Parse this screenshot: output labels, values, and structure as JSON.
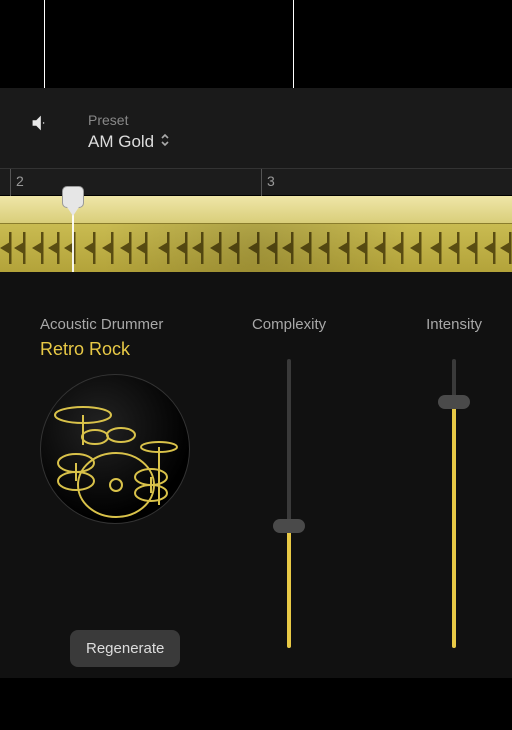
{
  "header": {
    "preset_label": "Preset",
    "preset_value": "AM Gold"
  },
  "ruler": {
    "bars": [
      "2",
      "3"
    ]
  },
  "drummer": {
    "category": "Acoustic Drummer",
    "name": "Retro Rock"
  },
  "sliders": {
    "complexity": {
      "label": "Complexity",
      "value": 0.42
    },
    "intensity": {
      "label": "Intensity",
      "value": 0.85
    }
  },
  "regenerate_label": "Regenerate",
  "colors": {
    "accent": "#e8c946",
    "background": "#111"
  }
}
